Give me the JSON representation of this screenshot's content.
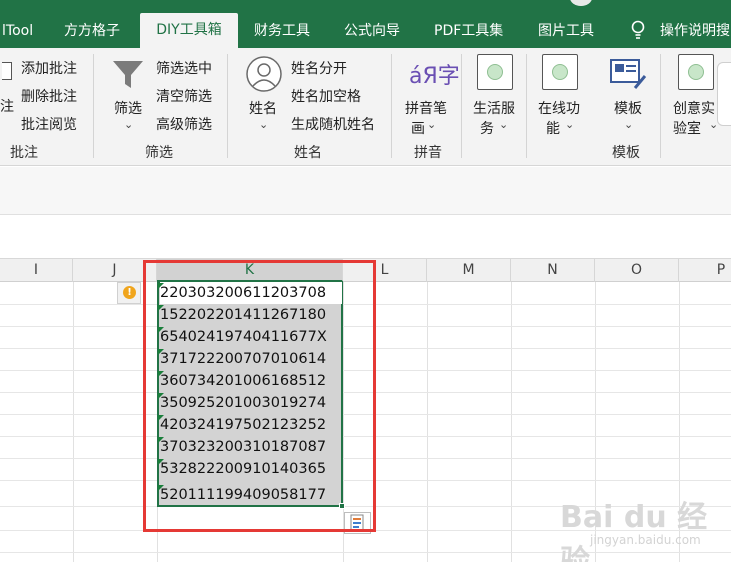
{
  "tabs": [
    "lTool",
    "方方格子",
    "DIY工具箱",
    "财务工具",
    "公式向导",
    "PDF工具集",
    "图片工具",
    "操作说明搜"
  ],
  "ribbon": {
    "annot": {
      "item1": "添加批注",
      "item2": "删除批注",
      "item3": "批注阅览",
      "left_char": "注",
      "group": "批注"
    },
    "filter": {
      "btn": "筛选",
      "item1": "筛选选中",
      "item2": "清空筛选",
      "item3": "高级筛选",
      "group": "筛选"
    },
    "name": {
      "btn": "姓名",
      "item1": "姓名分开",
      "item2": "姓名加空格",
      "item3": "生成随机姓名",
      "group": "姓名"
    },
    "pinyin": {
      "btn_line1": "拼音笔",
      "btn_line2": "画",
      "group": "拼音",
      "icon_text": "áЯ字"
    },
    "life": {
      "line1": "生活服",
      "line2": "务"
    },
    "online": {
      "line1": "在线功",
      "line2": "能"
    },
    "template": {
      "btn": "模板",
      "group": "模板"
    },
    "creative": {
      "line1": "创意实",
      "line2": "验室"
    }
  },
  "columns": [
    "I",
    "J",
    "K",
    "L",
    "M",
    "N",
    "O",
    "P"
  ],
  "cells": [
    "220303200611203708",
    "152202201411267180",
    "65402419740411677X",
    "371722200707010614",
    "360734201006168512",
    "350925201003019274",
    "420324197502123252",
    "370323200310187087",
    "532822200910140365",
    "520111199409058177"
  ],
  "watermark": {
    "text": "Bai du 经验",
    "url": "jingyan.baidu.com"
  },
  "colors": {
    "accent": "#217346",
    "highlight": "#e53935",
    "warning": "#f0a51d"
  }
}
